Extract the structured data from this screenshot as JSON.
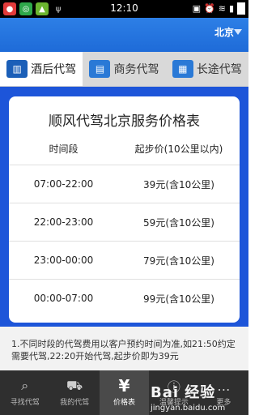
{
  "status_bar": {
    "time": "12:10",
    "left_icons": [
      "app-icon-1",
      "app-icon-2",
      "android-icon",
      "usb-icon"
    ],
    "right_icons": [
      "photo-icon",
      "alarm-icon",
      "wifi-icon",
      "signal-icon",
      "battery-icon"
    ]
  },
  "header": {
    "city": "北京",
    "city_caret": "▽"
  },
  "tabs": [
    {
      "label": "酒后代驾",
      "icon": "trash-can-icon",
      "active": true
    },
    {
      "label": "商务代驾",
      "icon": "briefcase-icon",
      "active": false
    },
    {
      "label": "长途代驾",
      "icon": "luggage-icon",
      "active": false
    }
  ],
  "price_table": {
    "title": "顺风代驾北京服务价格表",
    "header": {
      "col1": "时间段",
      "col2": "起步价(10公里以内)"
    },
    "rows": [
      {
        "time": "07:00-22:00",
        "price": "39元(含10公里)"
      },
      {
        "time": "22:00-23:00",
        "price": "59元(含10公里)"
      },
      {
        "time": "23:00-00:00",
        "price": "79元(含10公里)"
      },
      {
        "time": "00:00-07:00",
        "price": "99元(含10公里)"
      }
    ]
  },
  "notes": {
    "text": "1.不同时段的代驾费用以客户预约时间为准,如21:50约定需要代驾,22:20开始代驾,起步价即为39元"
  },
  "bottom_nav": [
    {
      "label": "寻找代驾",
      "icon": "search-icon",
      "active": false
    },
    {
      "label": "我的代驾",
      "icon": "car-icon",
      "active": false
    },
    {
      "label": "价格表",
      "icon": "yen-icon",
      "active": true
    },
    {
      "label": "温馨提示",
      "icon": "info-icon",
      "active": false
    },
    {
      "label": "更多",
      "icon": "more-icon",
      "active": false
    }
  ],
  "watermark": {
    "brand": "Bai 经验",
    "url": "jingyan.baidu.com"
  }
}
